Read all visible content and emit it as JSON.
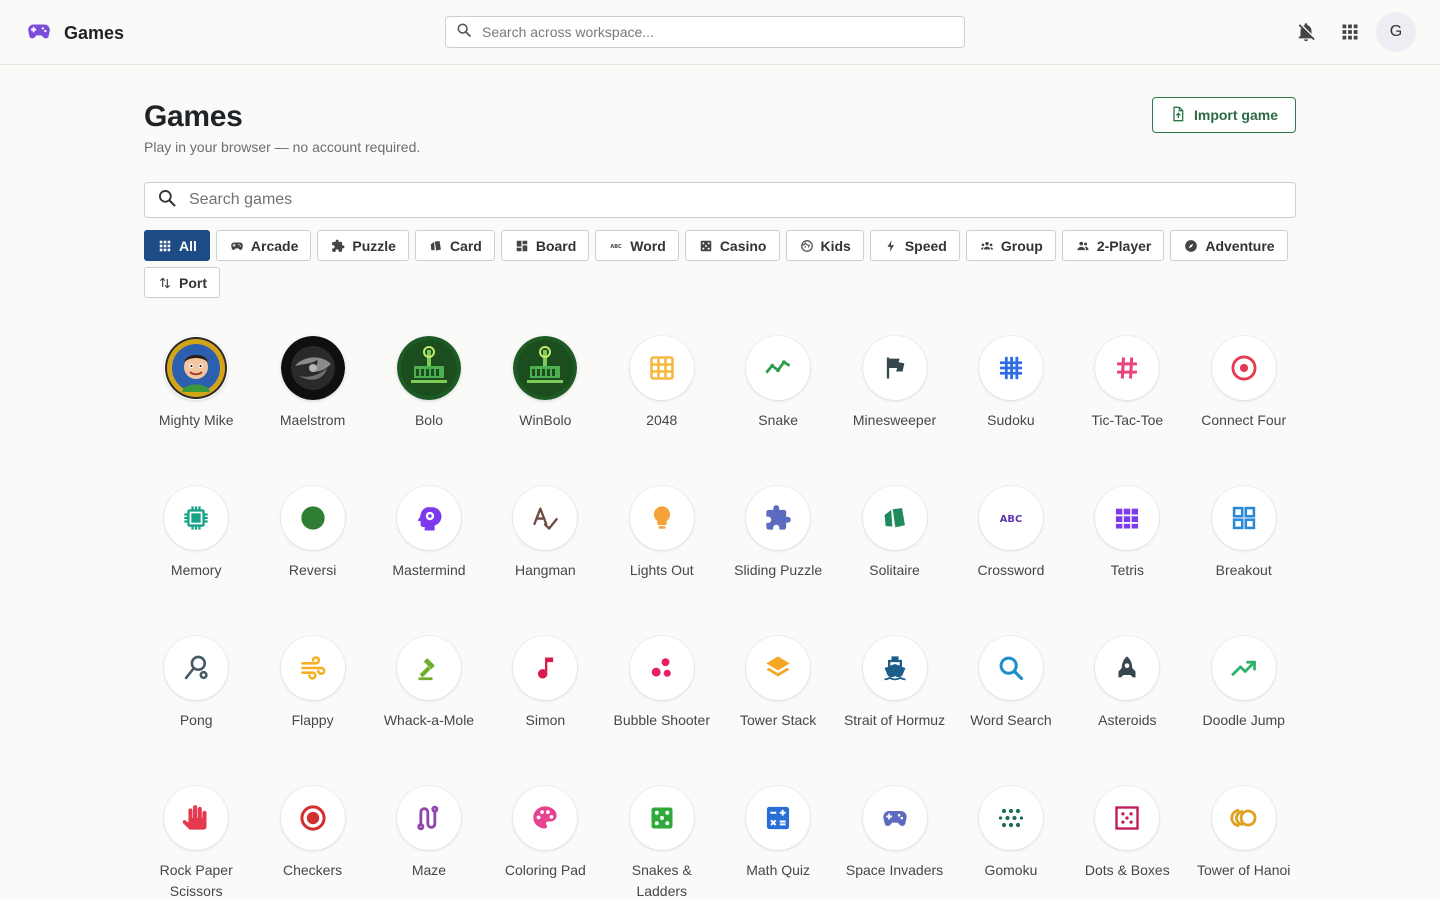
{
  "header": {
    "title": "Games",
    "search_placeholder": "Search across workspace...",
    "avatar_initial": "G"
  },
  "page": {
    "title": "Games",
    "subtitle": "Play in your browser — no account required.",
    "import_label": "Import game",
    "search_placeholder": "Search games"
  },
  "colors": {
    "accent": "#1d4b86",
    "brand": "#7c4ddb",
    "import": "#2d7a4a"
  },
  "filters": [
    {
      "label": "All",
      "icon": "grid-icon",
      "active": true
    },
    {
      "label": "Arcade",
      "icon": "gamepad-icon"
    },
    {
      "label": "Puzzle",
      "icon": "puzzle-icon"
    },
    {
      "label": "Card",
      "icon": "cards-icon"
    },
    {
      "label": "Board",
      "icon": "dashboard-icon"
    },
    {
      "label": "Word",
      "icon": "abc-icon"
    },
    {
      "label": "Casino",
      "icon": "dice-icon"
    },
    {
      "label": "Kids",
      "icon": "face-icon"
    },
    {
      "label": "Speed",
      "icon": "bolt-icon"
    },
    {
      "label": "Group",
      "icon": "group-icon"
    },
    {
      "label": "2-Player",
      "icon": "people-icon"
    },
    {
      "label": "Adventure",
      "icon": "compass-icon"
    },
    {
      "label": "Port",
      "icon": "swap-icon"
    }
  ],
  "games": [
    {
      "name": "Mighty Mike",
      "icon": "mighty-mike-icon",
      "color": "#d4a418"
    },
    {
      "name": "Maelstrom",
      "icon": "maelstrom-icon",
      "color": "#2a2a2a"
    },
    {
      "name": "Bolo",
      "icon": "bolo-tank-icon",
      "color": "#1e5a24"
    },
    {
      "name": "WinBolo",
      "icon": "winbolo-tank-icon",
      "color": "#1e5a24"
    },
    {
      "name": "2048",
      "icon": "grid-3x3-icon",
      "color": "#f5b942"
    },
    {
      "name": "Snake",
      "icon": "trend-line-icon",
      "color": "#2e9d4e"
    },
    {
      "name": "Minesweeper",
      "icon": "flag-icon",
      "color": "#37474f"
    },
    {
      "name": "Sudoku",
      "icon": "hash-grid-icon",
      "color": "#2f6fe0"
    },
    {
      "name": "Tic-Tac-Toe",
      "icon": "hash-icon",
      "color": "#e8457a"
    },
    {
      "name": "Connect Four",
      "icon": "target-icon",
      "color": "#e53950"
    },
    {
      "name": "Memory",
      "icon": "chip-icon",
      "color": "#18a389"
    },
    {
      "name": "Reversi",
      "icon": "circle-icon",
      "color": "#2e7d32"
    },
    {
      "name": "Mastermind",
      "icon": "head-gear-icon",
      "color": "#7c3aed"
    },
    {
      "name": "Hangman",
      "icon": "spellcheck-icon",
      "color": "#6d4c41"
    },
    {
      "name": "Lights Out",
      "icon": "lightbulb-icon",
      "color": "#f6a23c"
    },
    {
      "name": "Sliding Puzzle",
      "icon": "puzzle-piece-icon",
      "color": "#5c6bc0"
    },
    {
      "name": "Solitaire",
      "icon": "cards-icon",
      "color": "#1f8a5a"
    },
    {
      "name": "Crossword",
      "icon": "abc-icon",
      "color": "#5e35b1"
    },
    {
      "name": "Tetris",
      "icon": "blocks-icon",
      "color": "#7c3aed"
    },
    {
      "name": "Breakout",
      "icon": "dashboard-grid-icon",
      "color": "#2b8ad8"
    },
    {
      "name": "Pong",
      "icon": "paddle-icon",
      "color": "#455a64"
    },
    {
      "name": "Flappy",
      "icon": "wind-icon",
      "color": "#f5b020"
    },
    {
      "name": "Whack-a-Mole",
      "icon": "gavel-icon",
      "color": "#6fae2b"
    },
    {
      "name": "Simon",
      "icon": "music-note-icon",
      "color": "#d81b4a"
    },
    {
      "name": "Bubble Shooter",
      "icon": "bubbles-icon",
      "color": "#e91e63"
    },
    {
      "name": "Tower Stack",
      "icon": "layers-icon",
      "color": "#f5a623"
    },
    {
      "name": "Strait of Hormuz",
      "icon": "ship-icon",
      "color": "#1c5d8a"
    },
    {
      "name": "Word Search",
      "icon": "search-icon",
      "color": "#1a8fc9"
    },
    {
      "name": "Asteroids",
      "icon": "rocket-icon",
      "color": "#37474f"
    },
    {
      "name": "Doodle Jump",
      "icon": "trending-up-icon",
      "color": "#2db36b"
    },
    {
      "name": "Rock Paper Scissors",
      "icon": "hand-icon",
      "color": "#e53950"
    },
    {
      "name": "Checkers",
      "icon": "radio-target-icon",
      "color": "#d32f2f"
    },
    {
      "name": "Maze",
      "icon": "route-icon",
      "color": "#8e44ad"
    },
    {
      "name": "Coloring Pad",
      "icon": "palette-icon",
      "color": "#e84393"
    },
    {
      "name": "Snakes & Ladders",
      "icon": "dice-icon",
      "color": "#2eaa3a"
    },
    {
      "name": "Math Quiz",
      "icon": "calculator-icon",
      "color": "#2a6fd8"
    },
    {
      "name": "Space Invaders",
      "icon": "gamepad-icon",
      "color": "#5c6bc0"
    },
    {
      "name": "Gomoku",
      "icon": "dots-grid-icon",
      "color": "#1e6b5a"
    },
    {
      "name": "Dots & Boxes",
      "icon": "dotted-box-icon",
      "color": "#c2185b"
    },
    {
      "name": "Tower of Hanoi",
      "icon": "rings-icon",
      "color": "#e0a020"
    }
  ]
}
